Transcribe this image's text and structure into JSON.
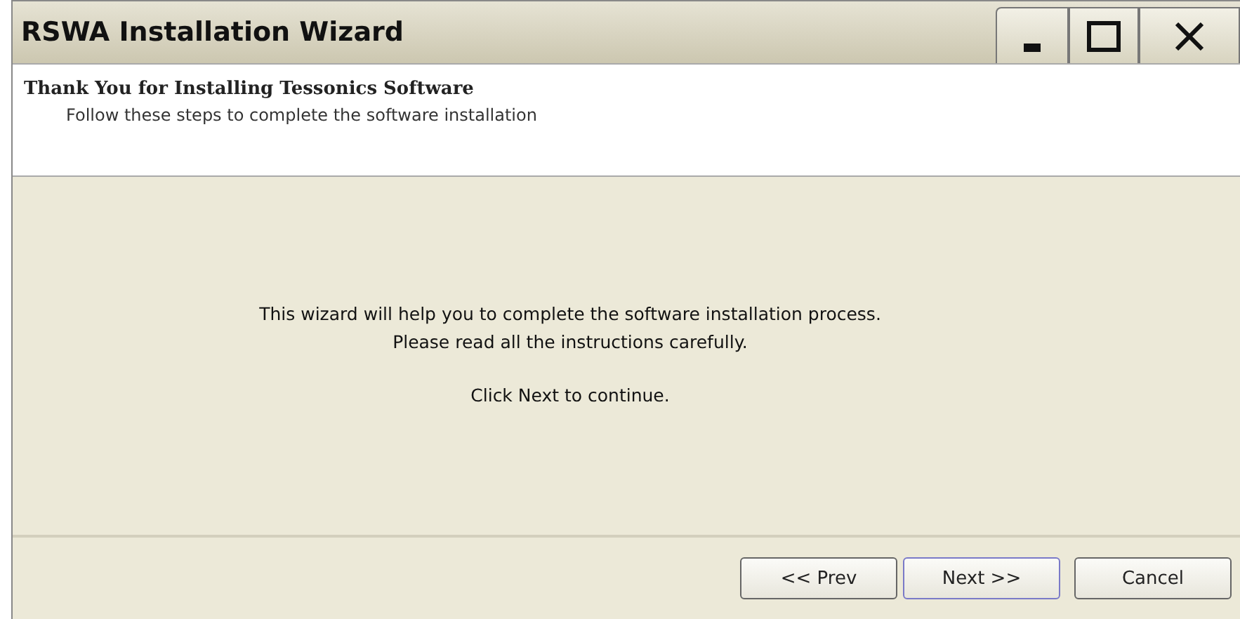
{
  "window": {
    "title": "RSWA Installation Wizard"
  },
  "header": {
    "title": "Thank You for Installing Tessonics Software",
    "subtitle": "Follow these steps to complete the software installation"
  },
  "body": {
    "lines": [
      "This wizard will help you to complete the software installation process.",
      "Please read all the instructions carefully.",
      "Click Next to continue."
    ]
  },
  "buttons": [
    {
      "label": "<< Prev",
      "focused": false
    },
    {
      "label": "Next >>",
      "focused": true
    },
    {
      "label": "Cancel",
      "focused": false
    }
  ]
}
